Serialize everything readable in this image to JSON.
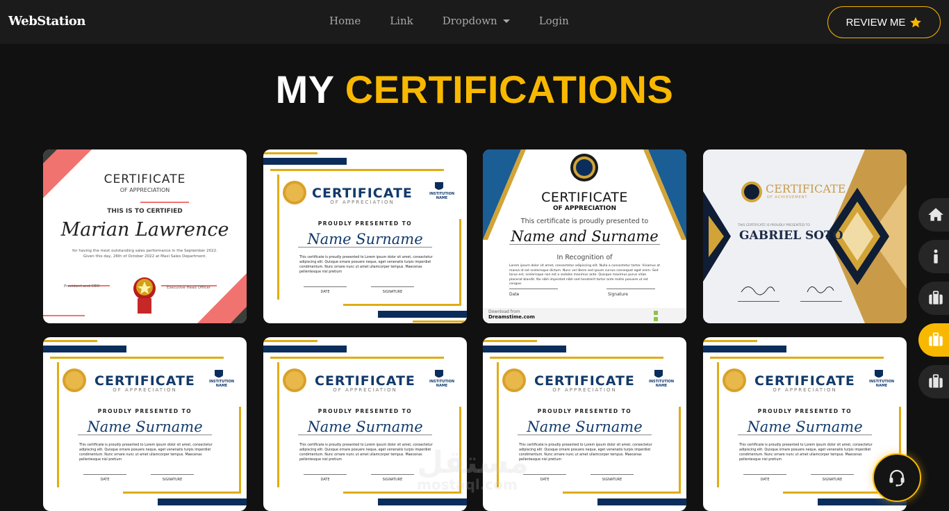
{
  "nav": {
    "brand": "WebStation",
    "links": [
      "Home",
      "Link",
      "Dropdown",
      "Login"
    ],
    "review_label": "REVIEW ME"
  },
  "title": {
    "part1": "MY",
    "part2": "CERTIFICATIONS"
  },
  "colors": {
    "accent": "#f9b800",
    "bg": "#111111",
    "navy": "#0b2d5b"
  },
  "cards": [
    {
      "heading": "CERTIFICATE",
      "sub": "OF APPRECIATION",
      "line": "THIS IS TO CERTIFIED",
      "name": "Marian Lawrence",
      "body": "for having the most outstanding sales performance in the September 2022. Given this day, 26th of October 2022 at Maxi Sales Department.",
      "sig1": "President and CEO",
      "sig2": "Executive Head Officer"
    },
    {
      "heading": "CERTIFICATE",
      "sub": "OF APPRECIATION",
      "institution": "INSTITUTION NAME",
      "presented": "PROUDLY PRESENTED TO",
      "name": "Name Surname",
      "body": "This certificate is proudly presented to Lorem ipsum dolor sit amet, consectetur adipiscing elit. Quisque ornare posuere neque, eget venenatis turpis imperdiet condimentum. Nunc ornare nunc ut amet ullamcorper tempus. Maecenas pellentesque nisl pretium",
      "date": "DATE",
      "signature": "SIGNATURE"
    },
    {
      "heading": "CERTIFICATE",
      "sub": "OF APPRECIATION",
      "presented": "This certificate is proudly presented to",
      "name": "Name and Surname",
      "recognition": "In Recognition of",
      "body": "Lorem ipsum dolor sit amet, consectetur adipiscing elit. Nulla a consectetur tortor. Vivamus at massa id est scelerisque dictum. Nunc vel libero sed ipsum cursus consequat eget enim. Sed lacus est, scelerisque non est a sodales maximus ante. Quisque maximus purus vitae placerat blandit. No nibh imperdiet nibh sed hendrerit tortor ante mollis posuere ut est congue.",
      "date": "Date",
      "signature": "Signature",
      "download": "Download from",
      "site": "Dreamstime.com"
    },
    {
      "heading": "CERTIFICATE",
      "sub": "OF ACHIEVEMENT",
      "presented": "THIS CERTIFICATE IS PROUDLY PRESENTED TO",
      "name": "GABRIEL SOTO"
    },
    {
      "heading": "CERTIFICATE",
      "sub": "OF APPRECIATION",
      "institution": "INSTITUTION NAME",
      "presented": "PROUDLY PRESENTED TO",
      "name": "Name Surname",
      "body": "This certificate is proudly presented to Lorem ipsum dolor sit amet, consectetur adipiscing elit. Quisque ornare posuere neque, eget venenatis turpis imperdiet condimentum. Nunc ornare nunc ut amet ullamcorper tempus. Maecenas pellentesque nisl pretium",
      "date": "DATE",
      "signature": "SIGNATURE"
    },
    {
      "heading": "CERTIFICATE",
      "sub": "OF APPRECIATION",
      "institution": "INSTITUTION NAME",
      "presented": "PROUDLY PRESENTED TO",
      "name": "Name Surname",
      "body": "This certificate is proudly presented to Lorem ipsum dolor sit amet, consectetur adipiscing elit. Quisque ornare posuere neque, eget venenatis turpis imperdiet condimentum. Nunc ornare nunc ut amet ullamcorper tempus. Maecenas pellentesque nisl pretium",
      "date": "DATE",
      "signature": "SIGNATURE"
    },
    {
      "heading": "CERTIFICATE",
      "sub": "OF APPRECIATION",
      "institution": "INSTITUTION NAME",
      "presented": "PROUDLY PRESENTED TO",
      "name": "Name Surname",
      "body": "This certificate is proudly presented to Lorem ipsum dolor sit amet, consectetur adipiscing elit. Quisque ornare posuere neque, eget venenatis turpis imperdiet condimentum. Nunc ornare nunc ut amet ullamcorper tempus. Maecenas pellentesque nisl pretium",
      "date": "DATE",
      "signature": "SIGNATURE"
    },
    {
      "heading": "CERTIFICATE",
      "sub": "OF APPRECIATION",
      "institution": "INSTITUTION NAME",
      "presented": "PROUDLY PRESENTED TO",
      "name": "Name Surname",
      "body": "This certificate is proudly presented to Lorem ipsum dolor sit amet, consectetur adipiscing elit. Quisque ornare posuere neque, eget venenatis turpis imperdiet condimentum. Nunc ornare nunc ut amet ullamcorper tempus. Maecenas pellentesque nisl pretium",
      "date": "DATE",
      "signature": "SIGNATURE"
    }
  ],
  "dock": [
    "home-icon",
    "info-icon",
    "briefcase-icon",
    "briefcase-icon",
    "briefcase-icon"
  ],
  "watermark": {
    "arabic": "مستقل",
    "latin": "mostaql.com"
  }
}
